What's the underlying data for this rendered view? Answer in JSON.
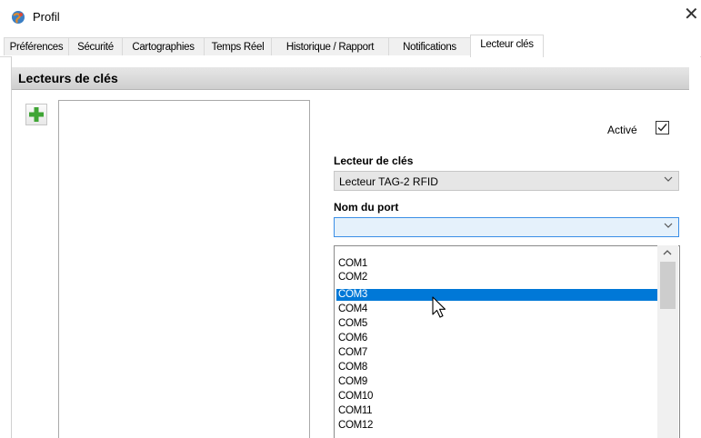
{
  "window": {
    "title": "Profil",
    "close_glyph": "✕"
  },
  "tabs": [
    {
      "label": "Préférences"
    },
    {
      "label": "Sécurité"
    },
    {
      "label": "Cartographies"
    },
    {
      "label": "Temps Réel"
    },
    {
      "label": "Historique / Rapport"
    },
    {
      "label": "Notifications"
    },
    {
      "label": "Lecteur clés",
      "active": true
    }
  ],
  "section": {
    "title": "Lecteurs de clés"
  },
  "settings": {
    "active_label": "Activé",
    "active_checked": true,
    "reader_label": "Lecteur de clés",
    "reader_value": "Lecteur TAG-2 RFID",
    "port_label": "Nom du port",
    "port_value": ""
  },
  "port_options": [
    "COM1",
    "COM2",
    "COM3",
    "COM4",
    "COM5",
    "COM6",
    "COM7",
    "COM8",
    "COM9",
    "COM10",
    "COM11",
    "COM12"
  ],
  "selected_port": "COM3",
  "colors": {
    "selection": "#0078d7",
    "add_icon": "#3fa535",
    "header_bg": "#d9d9d9"
  },
  "icons": {
    "app": "globe-icon",
    "add": "plus-icon",
    "close": "close-icon",
    "chevron": "chevron-down-icon"
  }
}
